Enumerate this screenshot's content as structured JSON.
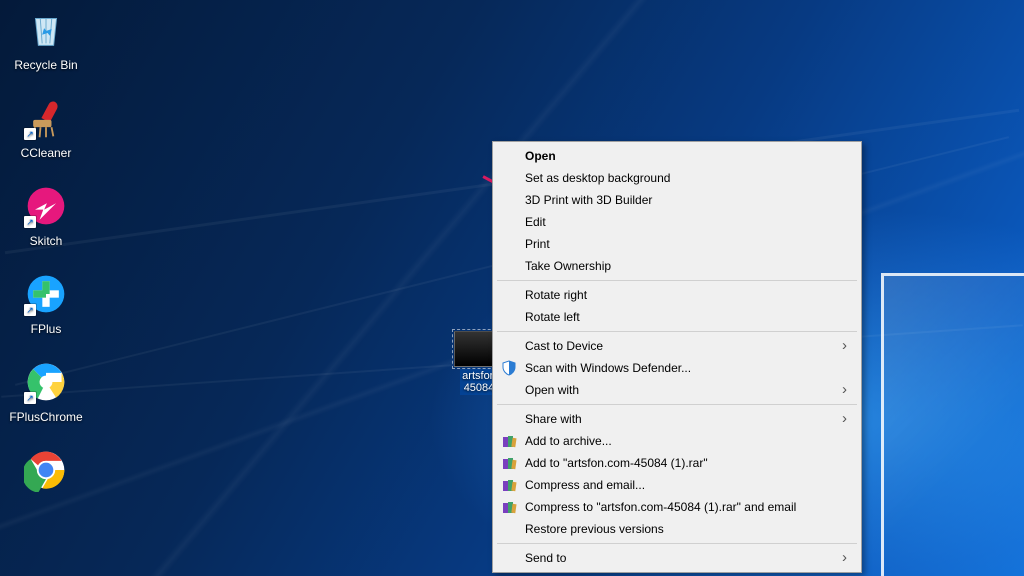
{
  "desktop": {
    "icons": [
      {
        "label": "Recycle Bin"
      },
      {
        "label": "CCleaner"
      },
      {
        "label": "Skitch"
      },
      {
        "label": "FPlus"
      },
      {
        "label": "FPlusChrome"
      },
      {
        "label": ""
      }
    ],
    "selected_file": {
      "line1": "artsfon",
      "line2": "45084"
    }
  },
  "context_menu": {
    "open": "Open",
    "set_bg": "Set as desktop background",
    "print3d": "3D Print with 3D Builder",
    "edit": "Edit",
    "print": "Print",
    "take_ownership": "Take Ownership",
    "rotate_right": "Rotate right",
    "rotate_left": "Rotate left",
    "cast": "Cast to Device",
    "defender": "Scan with Windows Defender...",
    "open_with": "Open with",
    "share_with": "Share with",
    "add_archive": "Add to archive...",
    "add_rar": "Add to \"artsfon.com-45084 (1).rar\"",
    "compress_email": "Compress and email...",
    "compress_rar_email": "Compress to \"artsfon.com-45084 (1).rar\" and email",
    "restore_prev": "Restore previous versions",
    "send_to": "Send to"
  }
}
